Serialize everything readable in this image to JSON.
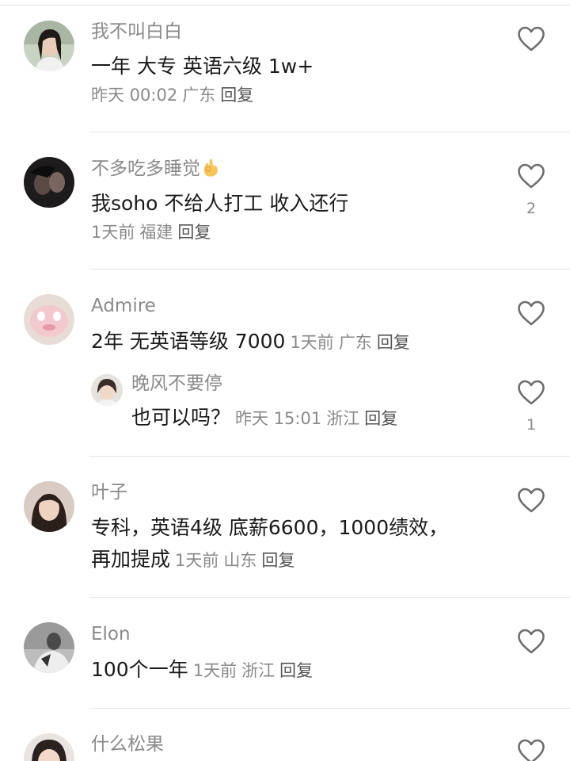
{
  "comments": [
    {
      "username": "我不叫白白",
      "content": "一年 大专 英语六级 1w+",
      "time": "昨天 00:02",
      "location": "广东",
      "reply": "回复",
      "likes": ""
    },
    {
      "username": "不多吃多睡觉",
      "content": "我soho 不给人打工 收入还行",
      "time": "1天前",
      "location": "福建",
      "reply": "回复",
      "likes": "2"
    },
    {
      "username": "Admire",
      "content": "2年 无英语等级 7000",
      "time": "1天前",
      "location": "广东",
      "reply": "回复",
      "likes": "",
      "sub_reply": {
        "username": "晚风不要停",
        "content": "也可以吗？",
        "time": "昨天 15:01",
        "location": "浙江",
        "reply": "回复",
        "likes": "1"
      }
    },
    {
      "username": "叶子",
      "content_line1": "专科，英语4级 底薪6600，1000绩效，",
      "content_line2": "再加提成",
      "time": "1天前",
      "location": "山东",
      "reply": "回复",
      "likes": ""
    },
    {
      "username": "Elon",
      "content": "100个一年",
      "time": "1天前",
      "location": "浙江",
      "reply": "回复",
      "likes": ""
    },
    {
      "username": "什么松果"
    }
  ],
  "icons": {
    "like": "heart-outline-icon",
    "emoji": "ok-hand-emoji"
  },
  "colors": {
    "text_primary": "#1a1a1a",
    "text_secondary": "#8a8a8a",
    "divider": "#e6e6e6",
    "icon": "#6e6e6e"
  }
}
